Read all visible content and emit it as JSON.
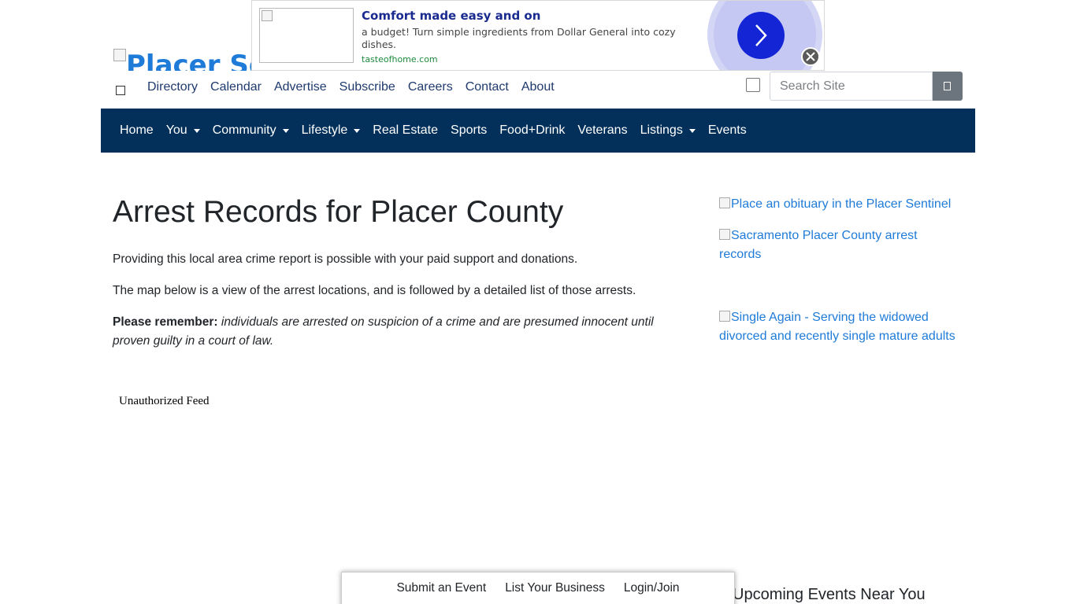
{
  "ad": {
    "headline": "Comfort made easy and on",
    "body": "a budget! Turn simple ingredients from Dollar General into cozy dishes.",
    "domain": "tasteofhome.com",
    "accent_color": "#1425d6"
  },
  "header": {
    "logo_text": "Placer Sentinel",
    "top_links": [
      "Directory",
      "Calendar",
      "Advertise",
      "Subscribe",
      "Careers",
      "Contact",
      "About"
    ],
    "search_placeholder": "Search Site"
  },
  "navbar": {
    "background_color": "#02305a",
    "items": [
      {
        "label": "Home",
        "dropdown": false
      },
      {
        "label": "You",
        "dropdown": true
      },
      {
        "label": "Community",
        "dropdown": true
      },
      {
        "label": "Lifestyle",
        "dropdown": true
      },
      {
        "label": "Real Estate",
        "dropdown": false
      },
      {
        "label": "Sports",
        "dropdown": false
      },
      {
        "label": "Food+Drink",
        "dropdown": false
      },
      {
        "label": "Veterans",
        "dropdown": false
      },
      {
        "label": "Listings",
        "dropdown": true
      },
      {
        "label": "Events",
        "dropdown": false
      }
    ]
  },
  "main": {
    "title": "Arrest Records for Placer County",
    "para1": "Providing this local area crime report is possible with your paid support and donations.",
    "para2": "The map below is a view of the arrest locations, and is followed by a detailed list of those arrests.",
    "reminder_label": "Please remember:",
    "reminder_text": "individuals are arrested on suspicion of a crime and are presumed innocent until proven guilty in a court of law.",
    "feed_text": "Unauthorized Feed"
  },
  "sidebar": {
    "links": [
      "Place an obituary in the Placer Sentinel",
      "Sacramento Placer County arrest records",
      "Single Again - Serving the widowed divorced and recently single mature adults"
    ],
    "upcoming_heading": "Upcoming Events Near You"
  },
  "bottombar": {
    "items": [
      "Submit an Event",
      "List Your Business",
      "Login/Join"
    ]
  }
}
